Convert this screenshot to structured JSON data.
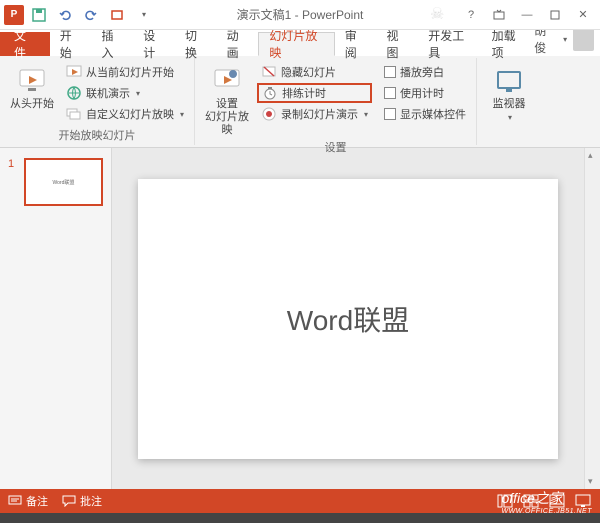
{
  "titlebar": {
    "app_initial": "P",
    "title": "演示文稿1 - PowerPoint"
  },
  "tabs": {
    "file": "文件",
    "home": "开始",
    "insert": "插入",
    "design": "设计",
    "transitions": "切换",
    "animations": "动画",
    "slideshow": "幻灯片放映",
    "review": "审阅",
    "view": "视图",
    "developer": "开发工具",
    "addins": "加载项",
    "user": "胡俊"
  },
  "ribbon": {
    "group1": {
      "start": "从头开始",
      "current": "从当前幻灯片开始",
      "online": "联机演示",
      "custom": "自定义幻灯片放映",
      "label": "开始放映幻灯片"
    },
    "group2": {
      "setup": "设置\n幻灯片放映",
      "hide": "隐藏幻灯片",
      "rehearse": "排练计时",
      "record": "录制幻灯片演示",
      "narration": "播放旁白",
      "timings": "使用计时",
      "media": "显示媒体控件",
      "label": "设置"
    },
    "group3": {
      "monitor": "监视器"
    }
  },
  "slide": {
    "number": "1",
    "thumb_text": "Word联盟",
    "text": "Word联盟"
  },
  "statusbar": {
    "notes": "备注",
    "comments": "批注"
  },
  "watermark": {
    "main": "office",
    "sub": "之家",
    "url": "WWW.OFFICE.JB51.NET"
  }
}
